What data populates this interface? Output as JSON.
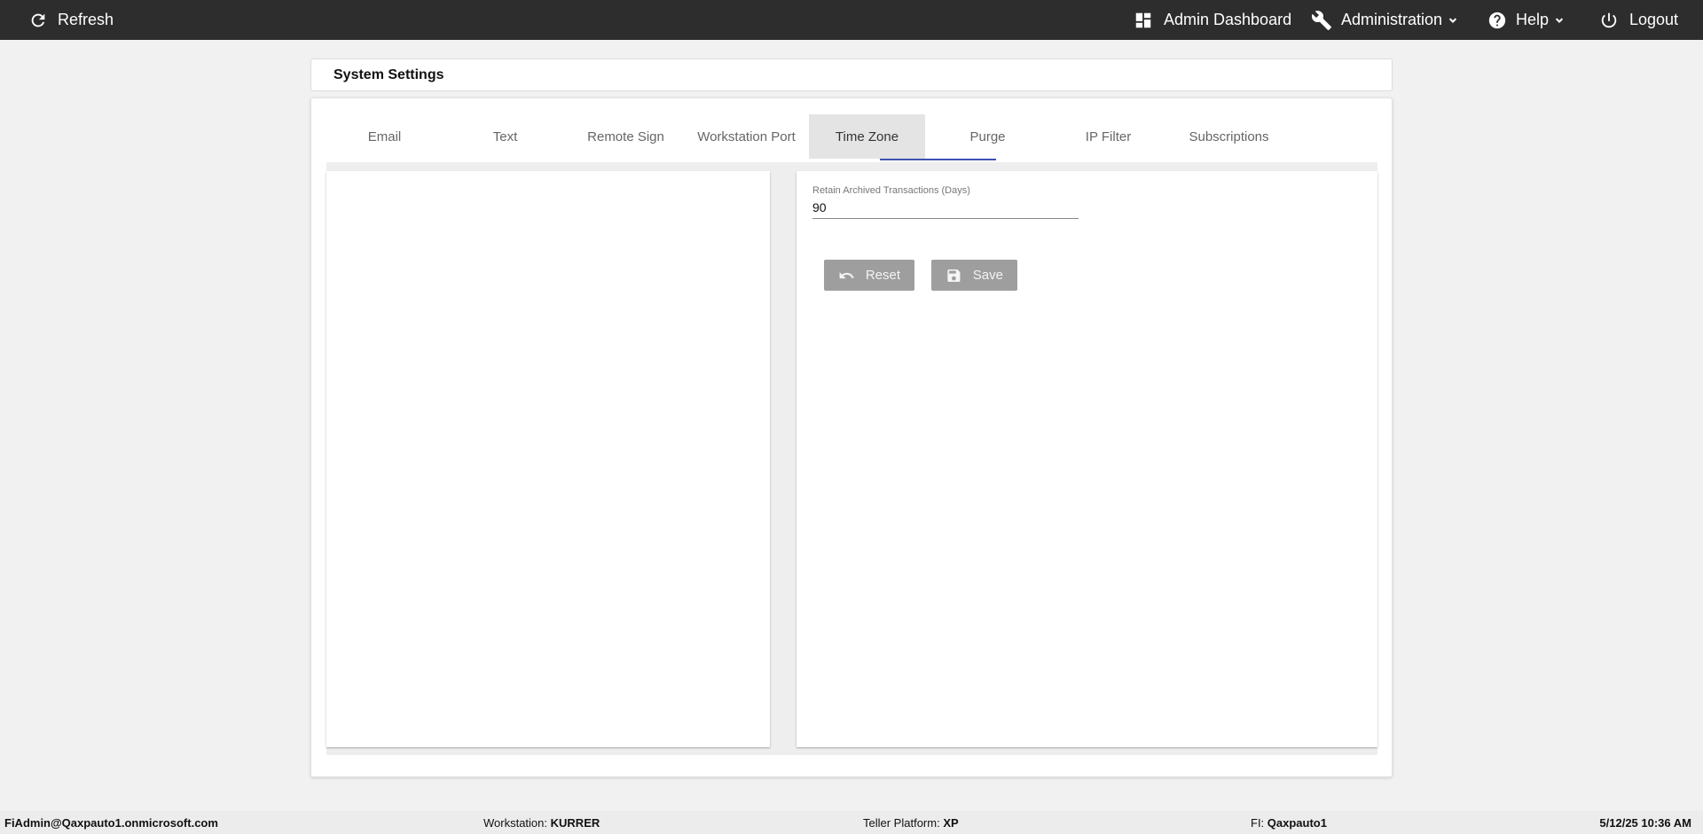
{
  "topbar": {
    "refresh_label": "Refresh",
    "admin_dashboard_label": "Admin Dashboard",
    "administration_label": "Administration",
    "help_label": "Help",
    "logout_label": "Logout"
  },
  "page": {
    "title": "System Settings"
  },
  "tabs": [
    {
      "label": "Email"
    },
    {
      "label": "Text"
    },
    {
      "label": "Remote Sign"
    },
    {
      "label": "Workstation Port"
    },
    {
      "label": "Time Zone"
    },
    {
      "label": "Purge"
    },
    {
      "label": "IP Filter"
    },
    {
      "label": "Subscriptions"
    }
  ],
  "active_tab": "Time Zone",
  "form": {
    "retain_label": "Retain Archived Transactions (Days)",
    "retain_value": "90",
    "reset_label": "Reset",
    "save_label": "Save"
  },
  "status": {
    "user": "FiAdmin@Qaxpauto1.onmicrosoft.com",
    "workstation_label": "Workstation:",
    "workstation_value": "KURRER",
    "teller_platform_label": "Teller Platform:",
    "teller_platform_value": "XP",
    "fi_label": "FI:",
    "fi_value": "Qaxpauto1",
    "datetime": "5/12/25 10:36 AM"
  },
  "colors": {
    "topbar_bg": "#2d2d2d",
    "tab_indicator": "#3f51b5",
    "button_bg": "#9e9e9e"
  }
}
